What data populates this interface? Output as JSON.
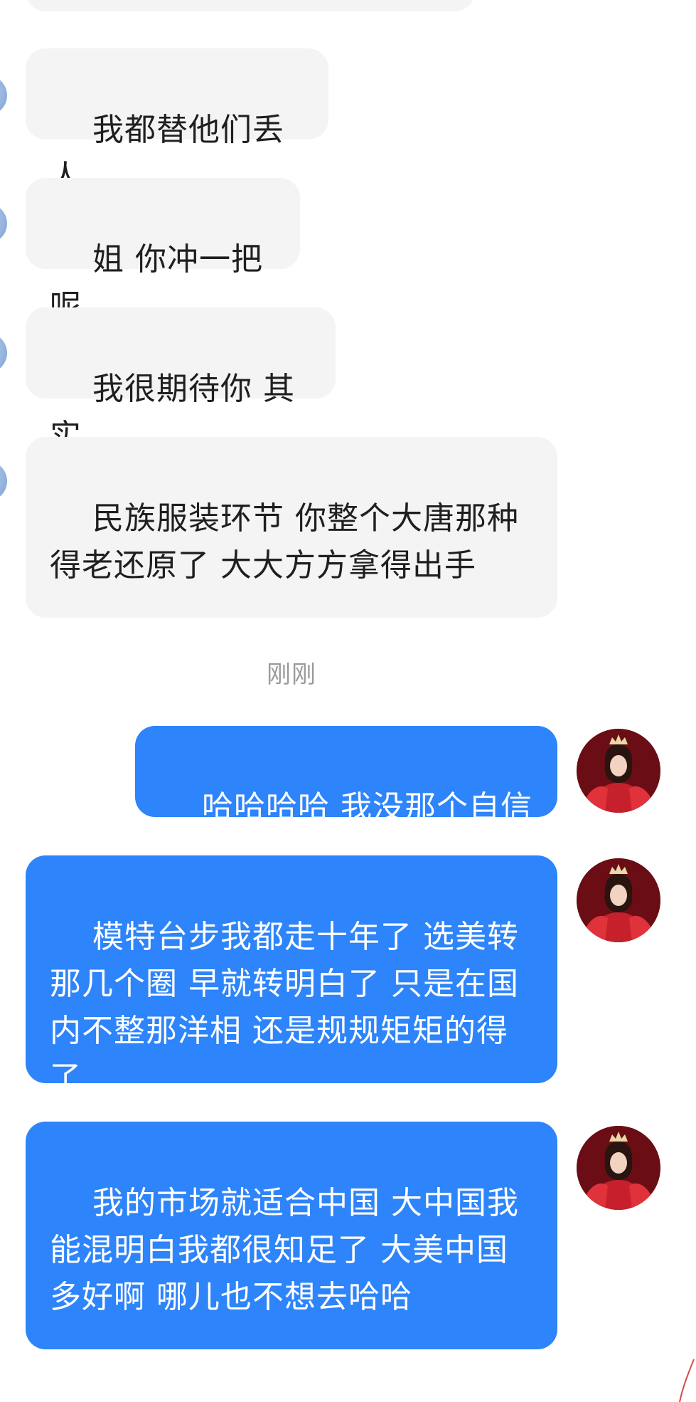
{
  "messages": {
    "m1": "我都替他们丢人",
    "m2": "姐 你冲一把呢",
    "m3": "我很期待你 其实",
    "m4": "民族服装环节 你整个大唐那种 得老还原了 大大方方拿得出手",
    "m5": "哈哈哈哈 我没那个自信",
    "m6": "模特台步我都走十年了 选美转那几个圈 早就转明白了 只是在国内不整那洋相 还是规规矩矩的得了",
    "m7": "我的市场就适合中国 大中国我能混明白我都很知足了 大美中国多好啊 哪儿也不想去哈哈"
  },
  "timestamp": "刚刚",
  "colors": {
    "incoming_bubble": "#f4f4f4",
    "outgoing_bubble": "#2d84fb",
    "timestamp_text": "#9a9a9a"
  },
  "icons": {
    "contact_avatar": "avatar-icon",
    "self_avatar": "avatar-icon"
  }
}
